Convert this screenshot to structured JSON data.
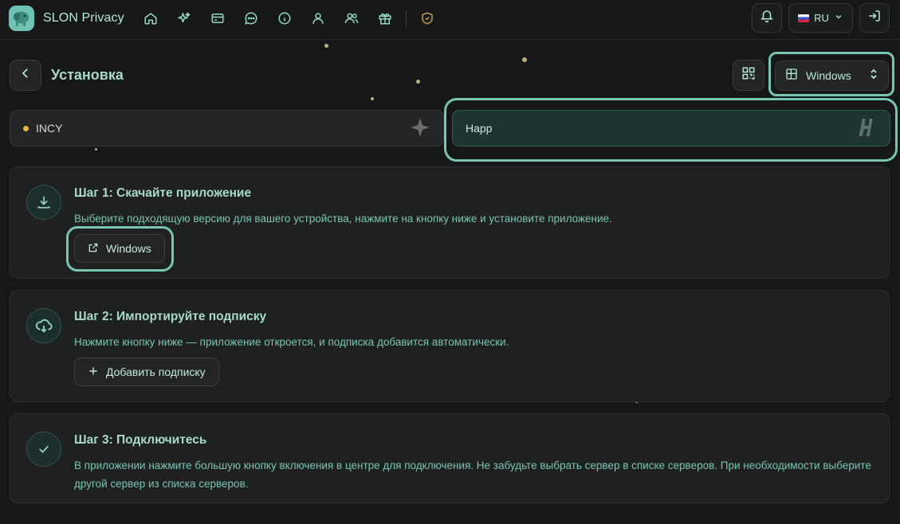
{
  "app": {
    "name": "SLON Privacy"
  },
  "nav": {
    "items": [
      "home-icon",
      "sparkles-icon",
      "card-icon",
      "chat-icon",
      "info-icon",
      "user-icon",
      "users-icon",
      "gift-icon",
      "shield-icon"
    ]
  },
  "header": {
    "language": "RU"
  },
  "page": {
    "title": "Установка",
    "platform": "Windows"
  },
  "apps": [
    {
      "name": "INCY",
      "status_color": "#e9b53c",
      "selected": false
    },
    {
      "name": "Happ",
      "selected": true
    }
  ],
  "steps": [
    {
      "title": "Шаг 1: Скачайте приложение",
      "description": "Выберите подходящую версию для вашего устройства, нажмите на кнопку ниже и установите приложение.",
      "button": "Windows"
    },
    {
      "title": "Шаг 2: Импортируйте подписку",
      "description": "Нажмите кнопку ниже — приложение откроется, и подписка добавится автоматически.",
      "button": "Добавить подписку"
    },
    {
      "title": "Шаг 3: Подключитесь",
      "description": "В приложении нажмите большую кнопку включения в центре для подключения. Не забудьте выбрать сервер в списке серверов. При необходимости выберите другой сервер из списка серверов."
    }
  ],
  "colors": {
    "accent": "#79c5b3",
    "background": "#161717",
    "card": "#1f2020"
  }
}
